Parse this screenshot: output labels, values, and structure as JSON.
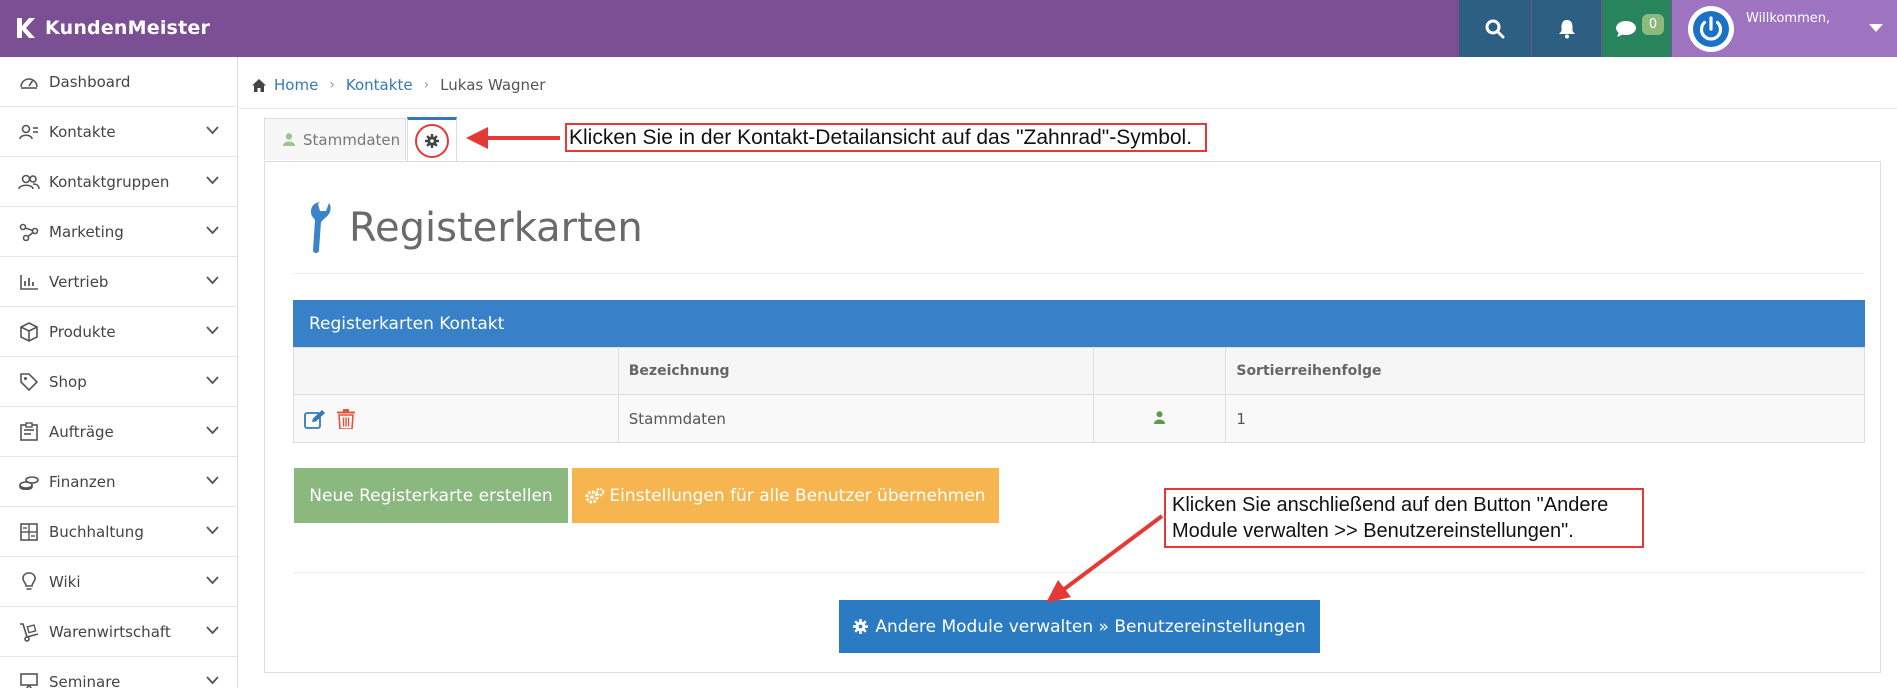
{
  "app": {
    "name": "KundenMeister",
    "brand_color": "#7a4f94"
  },
  "topbar": {
    "search_icon": "search-icon",
    "notification_icon": "bell-icon",
    "chat_icon": "chat-icon",
    "chat_count": "0",
    "welcome_text": "Willkommen,"
  },
  "sidebar": {
    "items": [
      {
        "label": "Dashboard",
        "icon": "dashboard-icon"
      },
      {
        "label": "Kontakte",
        "icon": "contacts-icon"
      },
      {
        "label": "Kontaktgruppen",
        "icon": "contact-groups-icon"
      },
      {
        "label": "Marketing",
        "icon": "marketing-icon"
      },
      {
        "label": "Vertrieb",
        "icon": "chart-icon"
      },
      {
        "label": "Produkte",
        "icon": "box-icon"
      },
      {
        "label": "Shop",
        "icon": "tag-icon"
      },
      {
        "label": "Aufträge",
        "icon": "orders-icon"
      },
      {
        "label": "Finanzen",
        "icon": "coins-icon"
      },
      {
        "label": "Buchhaltung",
        "icon": "calculator-icon"
      },
      {
        "label": "Wiki",
        "icon": "lightbulb-icon"
      },
      {
        "label": "Warenwirtschaft",
        "icon": "hand-truck-icon"
      },
      {
        "label": "Seminare",
        "icon": "seminar-icon"
      }
    ]
  },
  "breadcrumb": {
    "home": "Home",
    "contacts": "Kontakte",
    "current": "Lukas Wagner"
  },
  "tabs": {
    "stammdaten": "Stammdaten"
  },
  "page": {
    "title": "Registerkarten"
  },
  "table": {
    "heading": "Registerkarten Kontakt",
    "columns": [
      "",
      "Bezeichnung",
      "",
      "Sortierreihenfolge"
    ],
    "rows": [
      {
        "name": "Stammdaten",
        "order": "1"
      }
    ]
  },
  "buttons": {
    "new_tab": "Neue Registerkarte erstellen",
    "apply_all": "Einstellungen für alle Benutzer übernehmen",
    "other_modules": "Andere Module verwalten » Benutzereinstellungen"
  },
  "annotations": {
    "callout_1": "Klicken Sie in der Kontakt-Detailansicht auf das \"Zahnrad\"-Symbol.",
    "callout_2": "Klicken Sie anschließend auf den Button \"Andere Module verwalten >> Benutzereinstellungen\".",
    "accent_color": "#e53935"
  }
}
